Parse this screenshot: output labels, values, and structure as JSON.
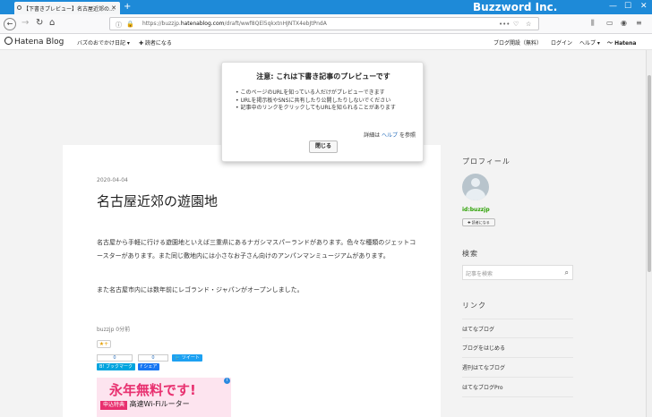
{
  "browser": {
    "tab_title": "【下書きプレビュー】名古屋近郊の...",
    "tab_close": "✕",
    "new_tab": "+",
    "brand": "Buzzword Inc.",
    "url_prefix": "https://buzzjp.",
    "url_host": "hatenablog.com",
    "url_path": "/draft/wwf8QEl5qkxtnHJNTX4ebJtPndA",
    "url_dots": "•••"
  },
  "hatena_bar": {
    "logo": "Hatena Blog",
    "blog_menu": "バズのおでかけ日記 ▾",
    "reader_button": "✚ 読者になる",
    "open_blog": "ブログ開設（無料）",
    "login": "ログイン",
    "help": "ヘルプ ▾",
    "hatena": "Hatena"
  },
  "popup": {
    "title": "注意: これは下書き記事のプレビューです",
    "items": [
      "このページのURLを知っている人だけがプレビューできます",
      "URLを掲示板やSNSに共有したり公開したりしないでください",
      "記事中のリンクをクリックしてもURLを知られることがあります"
    ],
    "help_prefix": "詳細は",
    "help_link": "ヘルプ",
    "help_suffix": "を参照",
    "close_button": "閉じる"
  },
  "article": {
    "date": "2020-04-04",
    "title": "名古屋近郊の遊園地",
    "paragraph1": "名古屋から手軽に行ける遊園地といえば三重県にあるナガシマスパーランドがあります。色々な種類のジェットコースターがあります。また同じ敷地内には小さなお子さん向けのアンパンマンミュージアムがあります。",
    "paragraph2": "また名古屋市内には数年前にレゴランド・ジャパンがオープンしました。",
    "author": "buzzjp 0分前",
    "star": "★+",
    "bookmark_count": "0",
    "share_count": "0",
    "bookmark_button": "B! ブックマーク",
    "share_button": "f シェア",
    "tweet_button": "ツイート"
  },
  "ad": {
    "headline": "永年無料です!",
    "badge": "申込特典",
    "text": "高速Wi-Fiルーター",
    "info": "i"
  },
  "sidebar": {
    "profile_heading": "プロフィール",
    "user_id": "id:buzzjp",
    "reader_button": "✚ 読者になる",
    "search_heading": "検索",
    "search_placeholder": "記事を検索",
    "links_heading": "リンク",
    "links": [
      "はてなブログ",
      "ブログをはじめる",
      "週刊はてなブログ",
      "はてなブログPro"
    ]
  },
  "colors": {
    "titlebar": "#1e8ad8",
    "user_id": "#2aa000",
    "link": "#2a6fbb"
  }
}
